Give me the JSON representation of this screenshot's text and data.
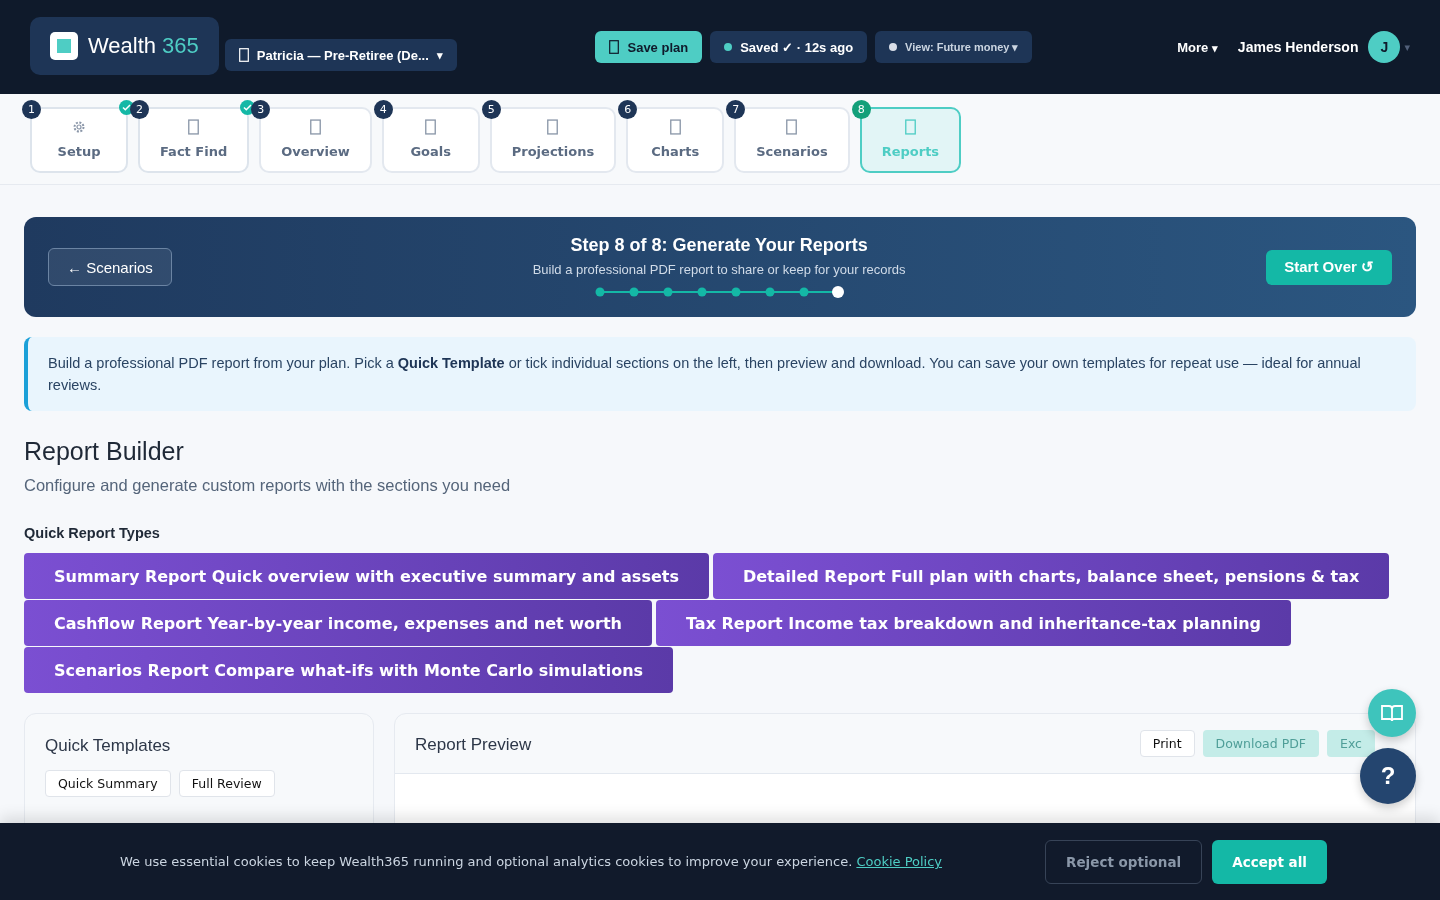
{
  "header": {
    "logo": {
      "word": "Wealth",
      "number": "365"
    },
    "client_picker": {
      "label": "Patricia — Pre-Retiree (De...",
      "caret": "▾"
    },
    "save_button": "Save plan",
    "save_status": {
      "label": "Saved ✓ · 12s ago"
    },
    "view_picker": {
      "label": "View: Future money ▾"
    },
    "more_menu": {
      "label": "More",
      "caret": "▾"
    },
    "user": {
      "name": "James Henderson",
      "initial": "J",
      "caret": "▾"
    }
  },
  "steps": [
    {
      "number": "1",
      "label": "Setup",
      "kind": "settings",
      "done": true,
      "selected": false
    },
    {
      "number": "2",
      "label": "Fact Find",
      "kind": "page",
      "done": true,
      "selected": false
    },
    {
      "number": "3",
      "label": "Overview",
      "kind": "page",
      "done": false,
      "selected": false
    },
    {
      "number": "4",
      "label": "Goals",
      "kind": "page",
      "done": false,
      "selected": false
    },
    {
      "number": "5",
      "label": "Projections",
      "kind": "page",
      "done": false,
      "selected": false
    },
    {
      "number": "6",
      "label": "Charts",
      "kind": "page",
      "done": false,
      "selected": false
    },
    {
      "number": "7",
      "label": "Scenarios",
      "kind": "page",
      "done": false,
      "selected": false
    },
    {
      "number": "8",
      "label": "Reports",
      "kind": "page",
      "done": false,
      "selected": true
    }
  ],
  "step_banner": {
    "back_button": "← Scenarios",
    "title": "Step 8 of 8: Generate Your Reports",
    "subtitle": "Build a professional PDF report to share or keep for your records",
    "progress_dots": [
      {
        "selected": false
      },
      {
        "selected": false
      },
      {
        "selected": false
      },
      {
        "selected": false
      },
      {
        "selected": false
      },
      {
        "selected": false
      },
      {
        "selected": false
      },
      {
        "selected": true
      }
    ],
    "start_over_button": "Start Over ↺"
  },
  "info_note": "Build a professional PDF report from your plan. Pick a **Quick Template** or tick individual sections on the left, then preview and download. You can save your own templates for repeat use — ideal for annual reviews.",
  "report_builder": {
    "title": "Report Builder",
    "subtitle": "Configure and generate custom reports with the sections you need"
  },
  "quick_report_types": {
    "title": "Quick Report Types",
    "items": [
      {
        "name": "Summary Report",
        "description": "Quick overview with executive summary and assets"
      },
      {
        "name": "Detailed Report",
        "description": "Full plan with charts, balance sheet, pensions & tax"
      },
      {
        "name": "Cashflow Report",
        "description": "Year-by-year income, expenses and net worth"
      },
      {
        "name": "Tax Report",
        "description": "Income tax breakdown and inheritance-tax planning"
      },
      {
        "name": "Scenarios Report",
        "description": "Compare what-ifs with Monte Carlo simulations"
      }
    ]
  },
  "quick_templates": {
    "title": "Quick Templates",
    "items": [
      {
        "label": "Quick Summary",
        "selected": false
      },
      {
        "label": "Full Review",
        "selected": false
      }
    ]
  },
  "report_preview": {
    "title": "Report Preview",
    "buttons": [
      {
        "label": "Print",
        "disabled": false
      },
      {
        "label": "Download PDF",
        "disabled": true
      },
      {
        "label": "Exc",
        "disabled": true
      }
    ]
  },
  "help_button": "?",
  "cookie_banner": {
    "text": "We use essential cookies to keep Wealth365 running and optional analytics cookies to improve your experience.",
    "link": "Cookie Policy",
    "reject_button": "Reject optional",
    "accept_button": "Accept all"
  }
}
